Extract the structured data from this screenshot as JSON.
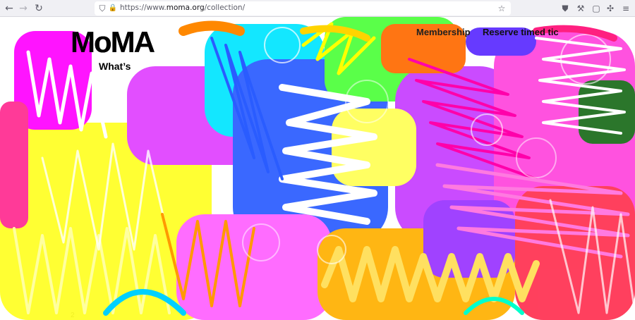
{
  "browser": {
    "url_prefix": "https://www.",
    "url_domain": "moma.org",
    "url_path": "/collection/",
    "icons": {
      "back": "back-arrow-icon",
      "forward": "forward-arrow-icon",
      "reload": "reload-icon",
      "shield": "tracking-shield-icon",
      "lock": "lock-icon",
      "bookmark": "bookmark-star-icon",
      "pocket": "pocket-icon",
      "tools": "wrench-icon",
      "extension": "extension-icon",
      "puzzle": "puzzle-icon",
      "menu": "hamburger-menu-icon"
    }
  },
  "site": {
    "logo": "MoMA",
    "whats_on": "What’s",
    "membership_link": "Membership",
    "tickets_link": "Reserve timed tic",
    "footer_year": "2"
  },
  "palette": {
    "magenta": "#ff00ff",
    "pink": "#ff3cc8",
    "yellow": "#ffff00",
    "cyan": "#00e5ff",
    "blue": "#2a5cff",
    "green": "#33ff33",
    "orange": "#ff8a00",
    "purple": "#7a1fff",
    "red": "#ff2040"
  }
}
